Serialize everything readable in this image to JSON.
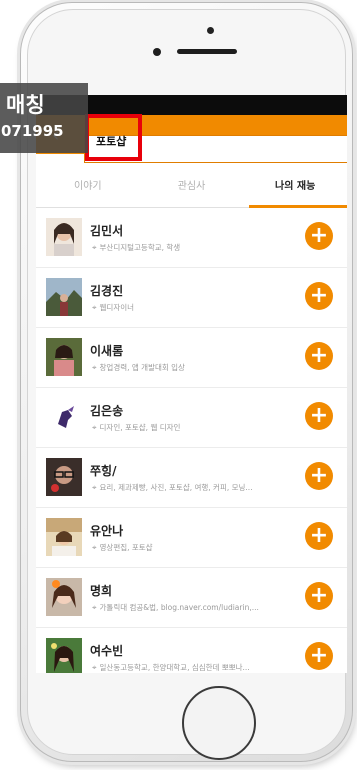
{
  "overlay": {
    "title": "매칭",
    "subtitle": "071995"
  },
  "search": {
    "value": "포토샵"
  },
  "tabs": [
    {
      "label": "이야기"
    },
    {
      "label": "관심사"
    },
    {
      "label": "나의 재능",
      "active": true
    }
  ],
  "users": [
    {
      "name": "김민서",
      "tags": "부산디지털고등학교, 학생"
    },
    {
      "name": "김경진",
      "tags": "웹디자이너"
    },
    {
      "name": "이새롬",
      "tags": "창업경력, 앱 개발대회 입상"
    },
    {
      "name": "김은송",
      "tags": "디자인, 포토샵, 웹 디자인"
    },
    {
      "name": "쭈힝/",
      "tags": "요리, 제과제빵, 사진, 포토샵, 여행, 커피, 모닝..."
    },
    {
      "name": "유안나",
      "tags": "영상편집, 포토샵"
    },
    {
      "name": "명희",
      "tags": "가톨릭대 컴공&법, blog.naver.com/ludiarin,..."
    },
    {
      "name": "여수빈",
      "tags": "일산동고등학교, 한양대학교, 심심한데 뽀뽀나..."
    }
  ],
  "icons": {
    "tag": "tag-icon",
    "add": "plus-icon",
    "back": "back-arrow-icon"
  },
  "colors": {
    "accent": "#f18a00",
    "highlight": "#e8000a",
    "overlay": "#464646"
  }
}
